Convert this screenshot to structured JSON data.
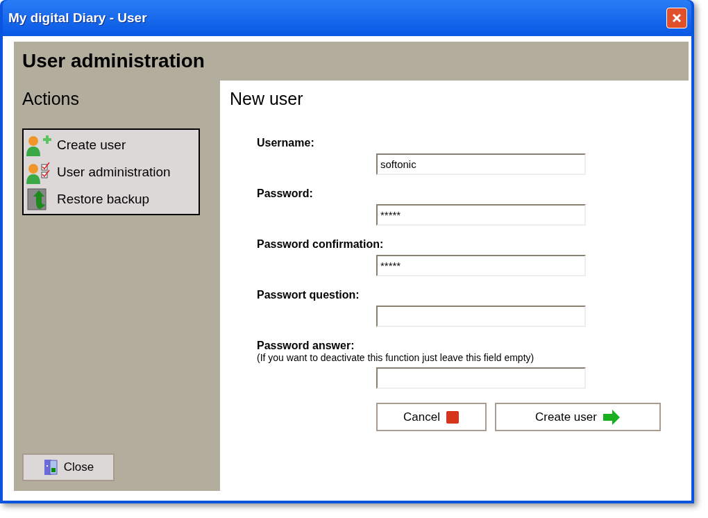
{
  "window": {
    "title": "My digital Diary - User"
  },
  "header": {
    "title": "User administration"
  },
  "sidebar": {
    "title": "Actions",
    "items": [
      {
        "label": "Create user",
        "kind": "create"
      },
      {
        "label": "User administration",
        "kind": "admin"
      },
      {
        "label": "Restore backup",
        "kind": "restore"
      }
    ],
    "close_button": "Close"
  },
  "form": {
    "title": "New user",
    "fields": [
      {
        "label": "Username:",
        "value": "softonic"
      },
      {
        "label": "Password:",
        "value": "*****"
      },
      {
        "label": "Password confirmation:",
        "value": "*****"
      },
      {
        "label": "Passwort question:"
      },
      {
        "label": "Password answer:",
        "note": "(If you want to deactivate this function just leave this field empty)"
      }
    ],
    "buttons": [
      {
        "label": "Cancel",
        "kind": "cancel"
      },
      {
        "label": "Create user",
        "kind": "submit"
      }
    ]
  }
}
